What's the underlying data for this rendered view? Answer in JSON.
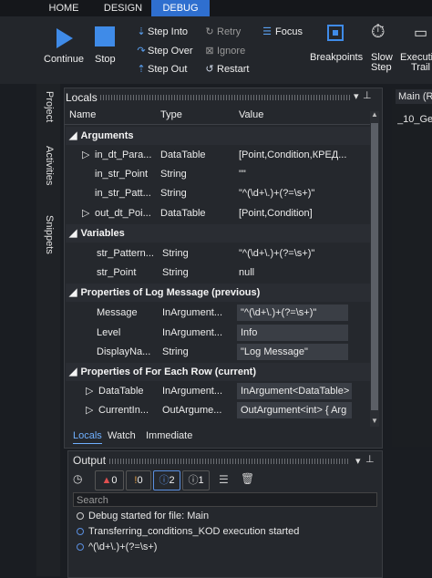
{
  "ribbon_tabs": [
    "HOME",
    "DESIGN",
    "DEBUG"
  ],
  "ribbon": {
    "continue": "Continue",
    "stop": "Stop",
    "step_into": "Step Into",
    "step_over": "Step Over",
    "step_out": "Step Out",
    "retry": "Retry",
    "ignore": "Ignore",
    "restart": "Restart",
    "focus": "Focus",
    "breakpoints": "Breakpoints",
    "slow_step_1": "Slow",
    "slow_step_2": "Step",
    "exec_trail_1": "Executi",
    "exec_trail_2": "Trail"
  },
  "rail": [
    "Project",
    "Activities",
    "Snippets"
  ],
  "locals": {
    "title": "Locals",
    "columns": [
      "Name",
      "Type",
      "Value"
    ],
    "sections": [
      {
        "title": "Arguments"
      },
      {
        "title": "Variables"
      },
      {
        "title": "Properties of Log Message (previous)"
      },
      {
        "title": "Properties of For Each Row (current)"
      }
    ],
    "rows": [
      {
        "name": "in_dt_Para...",
        "type": "DataTable",
        "value": "[Point,Condition,КРЕД..."
      },
      {
        "name": "in_str_Point",
        "type": "String",
        "value": "\"\""
      },
      {
        "name": "in_str_Patt...",
        "type": "String",
        "value": "\"^(\\d+\\.)+(?=\\s+)\""
      },
      {
        "name": "out_dt_Poi...",
        "type": "DataTable",
        "value": "[Point,Condition]"
      },
      {
        "name": "str_Pattern...",
        "type": "String",
        "value": "\"^(\\d+\\.)+(?=\\s+)\""
      },
      {
        "name": "str_Point",
        "type": "String",
        "value": "null"
      },
      {
        "name": "Message",
        "type": "InArgument...",
        "value": "\"^(\\d+\\.)+(?=\\s+)\""
      },
      {
        "name": "Level",
        "type": "InArgument...",
        "value": "Info"
      },
      {
        "name": "DisplayNa...",
        "type": "String",
        "value": "\"Log Message\""
      },
      {
        "name": "DataTable",
        "type": "InArgument...",
        "value": "InArgument<DataTable>"
      },
      {
        "name": "CurrentIn...",
        "type": "OutArgume...",
        "value": "OutArgument<int> { Arg"
      }
    ],
    "bottom_tabs": [
      "Locals",
      "Watch",
      "Immediate"
    ]
  },
  "doc_tab": {
    "title": "Main (R",
    "subtitle": "_10_Get"
  },
  "output": {
    "title": "Output",
    "filters": {
      "errors": "0",
      "warnings": "0",
      "info": "2",
      "trace": "1"
    },
    "search_placeholder": "Search",
    "lines": [
      "Debug started for file: Main",
      "Transferring_conditions_KOD execution started",
      "^(\\d+\\.)+(?=\\s+)"
    ]
  }
}
